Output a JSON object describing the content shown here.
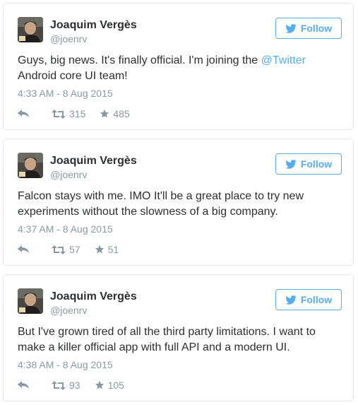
{
  "follow_label": "Follow",
  "colors": {
    "accent": "#55acee",
    "text": "#292f33",
    "muted": "#8899a6",
    "border": "#e1e8ed"
  },
  "icons": {
    "follow": "twitter-bird-icon",
    "reply": "reply-icon",
    "retweet": "retweet-icon",
    "favorite": "star-icon"
  },
  "tweets": [
    {
      "author": {
        "name": "Joaquim Vergès",
        "handle": "@joenrv"
      },
      "text_before": "Guys, big news. It's finally official. I'm joining the ",
      "mention": "@Twitter",
      "text_after": " Android core UI team!",
      "time": "4:33 AM - 8 Aug 2015",
      "retweets": "315",
      "favorites": "485"
    },
    {
      "author": {
        "name": "Joaquim Vergès",
        "handle": "@joenrv"
      },
      "text_before": "Falcon stays with me. IMO It'll be a great place to try new experiments without the slowness of a big company.",
      "mention": "",
      "text_after": "",
      "time": "4:37 AM - 8 Aug 2015",
      "retweets": "57",
      "favorites": "51"
    },
    {
      "author": {
        "name": "Joaquim Vergès",
        "handle": "@joenrv"
      },
      "text_before": "But I've grown tired of all the third party limitations. I want to make a killer official app with full API and a modern UI.",
      "mention": "",
      "text_after": "",
      "time": "4:38 AM - 8 Aug 2015",
      "retweets": "93",
      "favorites": "105"
    }
  ]
}
